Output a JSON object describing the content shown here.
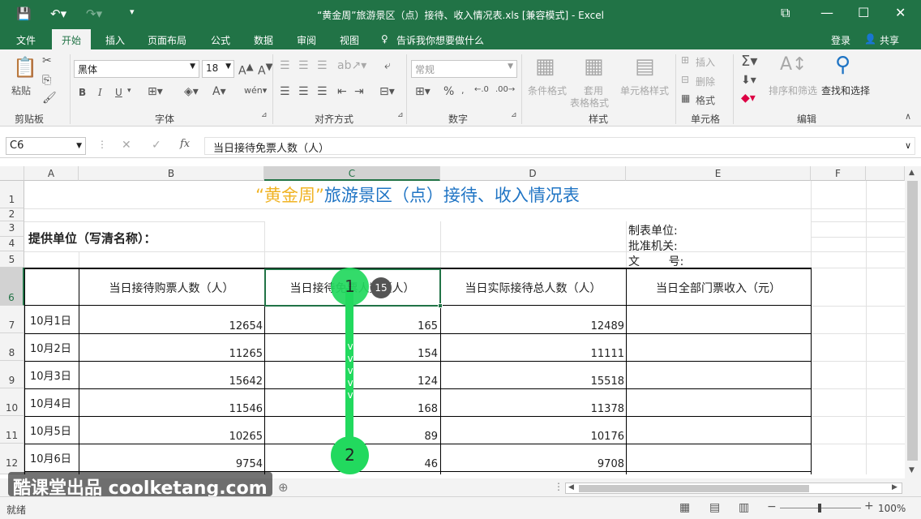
{
  "window": {
    "title": "“黄金周”旅游景区（点）接待、收入情况表.xls  [兼容模式] - Excel"
  },
  "ribbon_tabs": [
    "文件",
    "开始",
    "插入",
    "页面布局",
    "公式",
    "数据",
    "审阅",
    "视图"
  ],
  "tell_me": "告诉我你想要做什么",
  "account": {
    "login": "登录",
    "share": "共享"
  },
  "clipboard": {
    "paste": "粘贴",
    "group": "剪贴板"
  },
  "font": {
    "name": "黑体",
    "size": "18",
    "bold": "B",
    "italic": "I",
    "underline": "U",
    "group": "字体"
  },
  "alignment": {
    "group": "对齐方式"
  },
  "number": {
    "format": "常规",
    "group": "数字"
  },
  "styles": {
    "cond": "条件格式",
    "table1": "套用",
    "table2": "表格格式",
    "cell": "单元格样式",
    "group": "样式"
  },
  "cells": {
    "insert": "插入",
    "delete": "删除",
    "format": "格式",
    "group": "单元格"
  },
  "editing": {
    "sort": "排序和筛选",
    "find": "查找和选择",
    "group": "编辑"
  },
  "formula": {
    "name_box": "C6",
    "content": "当日接待免票人数（人）",
    "fx": "fx"
  },
  "columns": [
    "A",
    "B",
    "C",
    "D",
    "E",
    "F"
  ],
  "rows": [
    "1",
    "2",
    "3",
    "4",
    "5",
    "6",
    "7",
    "8",
    "9",
    "10",
    "11",
    "12"
  ],
  "sheet": {
    "title_quote": "“黄金周”",
    "title_rest": "旅游景区（点）接待、收入情况表",
    "provider": "提供单位（写清名称）：",
    "maker": "制表单位:",
    "approver": "批准机关:",
    "doc_no": "文        号:",
    "headers": [
      "当日接待购票人数（人）",
      "当日接待免票人数（人）",
      "当日实际接待总人数（人）",
      "当日全部门票收入（元）"
    ],
    "data": [
      {
        "date": "10月1日",
        "paid": "12654",
        "free": "165",
        "total": "12489"
      },
      {
        "date": "10月2日",
        "paid": "11265",
        "free": "154",
        "total": "11111"
      },
      {
        "date": "10月3日",
        "paid": "15642",
        "free": "124",
        "total": "15518"
      },
      {
        "date": "10月4日",
        "paid": "11546",
        "free": "168",
        "total": "11378"
      },
      {
        "date": "10月5日",
        "paid": "10265",
        "free": "89",
        "total": "10176"
      },
      {
        "date": "10月6日",
        "paid": "9754",
        "free": "46",
        "total": "9708"
      }
    ]
  },
  "overlay": {
    "step1": "1",
    "step2": "2",
    "badge": "15",
    "watermark": "酷课堂出品 coolketang.com"
  },
  "status": {
    "ready": "就绪",
    "zoom": "100%"
  },
  "colors": {
    "excel_green": "#217346",
    "overlay_green": "#22d95e",
    "title_gold": "#f0b323",
    "title_blue": "#1f74c4"
  }
}
